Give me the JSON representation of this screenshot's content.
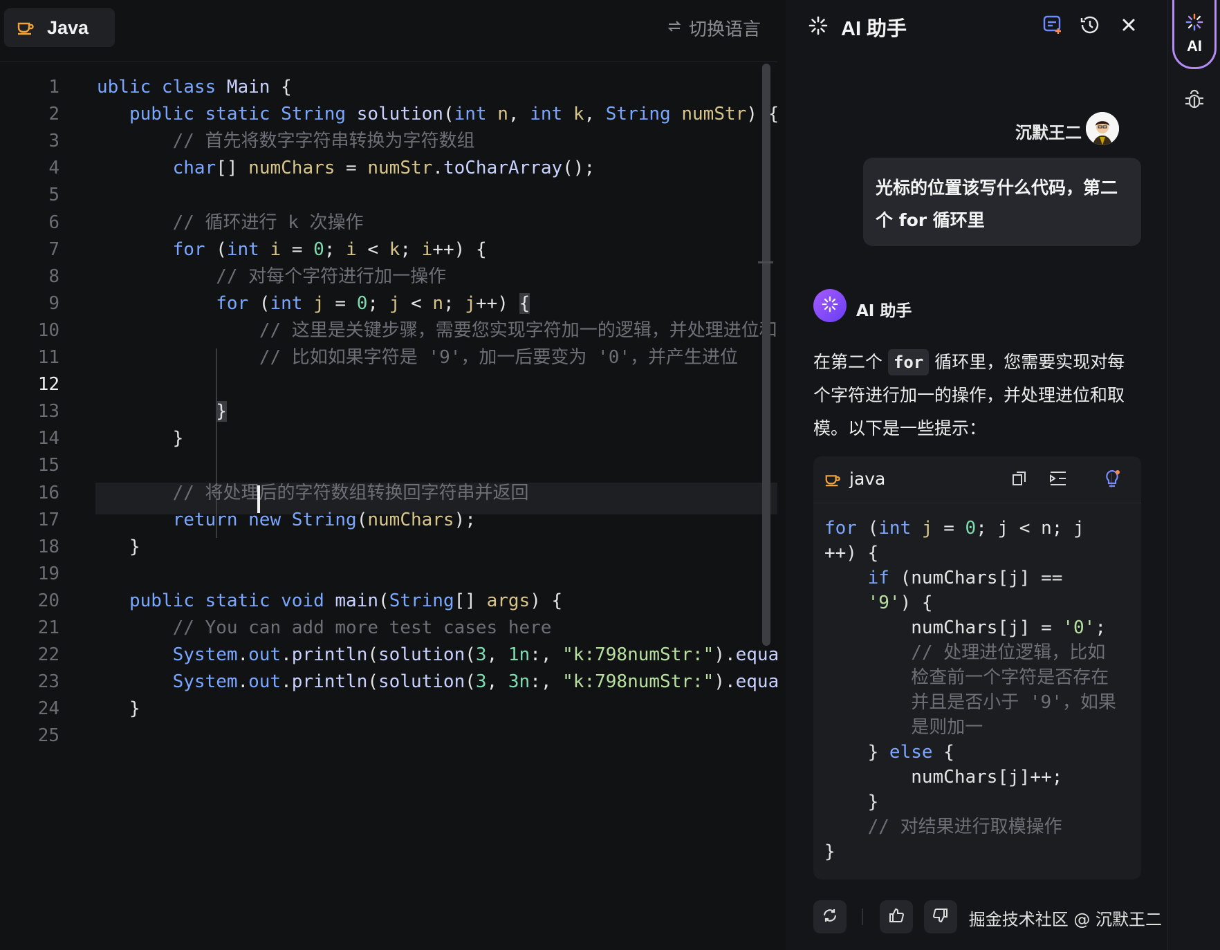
{
  "editor": {
    "language_tab": "Java",
    "switch_language": "切换语言",
    "lines": [
      {
        "n": "1",
        "segs": [
          [
            "kw",
            "ublic "
          ],
          [
            "kw",
            "class "
          ],
          [
            "fn",
            "Main"
          ],
          [
            "pl",
            " {"
          ]
        ]
      },
      {
        "n": "2",
        "segs": [
          [
            "pl",
            "   "
          ],
          [
            "kw",
            "public "
          ],
          [
            "kw",
            "static "
          ],
          [
            "ty",
            "String "
          ],
          [
            "fn",
            "solution"
          ],
          [
            "pl",
            "("
          ],
          [
            "kw",
            "int "
          ],
          [
            "id",
            "n"
          ],
          [
            "pl",
            ", "
          ],
          [
            "kw",
            "int "
          ],
          [
            "id",
            "k"
          ],
          [
            "pl",
            ", "
          ],
          [
            "ty",
            "String "
          ],
          [
            "id",
            "numStr"
          ],
          [
            "pl",
            ") {"
          ]
        ]
      },
      {
        "n": "3",
        "segs": [
          [
            "pl",
            "       "
          ],
          [
            "cm",
            "// 首先将数字字符串转换为字符数组"
          ]
        ]
      },
      {
        "n": "4",
        "segs": [
          [
            "pl",
            "       "
          ],
          [
            "kw",
            "char"
          ],
          [
            "pl",
            "[] "
          ],
          [
            "id",
            "numChars"
          ],
          [
            "pl",
            " = "
          ],
          [
            "id",
            "numStr"
          ],
          [
            "pl",
            "."
          ],
          [
            "fn",
            "toCharArray"
          ],
          [
            "pl",
            "();"
          ]
        ]
      },
      {
        "n": "5",
        "segs": []
      },
      {
        "n": "6",
        "segs": [
          [
            "pl",
            "       "
          ],
          [
            "cm",
            "// 循环进行 k 次操作"
          ]
        ]
      },
      {
        "n": "7",
        "segs": [
          [
            "pl",
            "       "
          ],
          [
            "kw",
            "for"
          ],
          [
            "pl",
            " ("
          ],
          [
            "kw",
            "int "
          ],
          [
            "id",
            "i"
          ],
          [
            "pl",
            " = "
          ],
          [
            "nm",
            "0"
          ],
          [
            "pl",
            "; "
          ],
          [
            "id",
            "i"
          ],
          [
            "pl",
            " < "
          ],
          [
            "id",
            "k"
          ],
          [
            "pl",
            "; "
          ],
          [
            "id",
            "i"
          ],
          [
            "pl",
            "++) {"
          ]
        ]
      },
      {
        "n": "8",
        "segs": [
          [
            "pl",
            "           "
          ],
          [
            "cm",
            "// 对每个字符进行加一操作"
          ]
        ]
      },
      {
        "n": "9",
        "segs": [
          [
            "pl",
            "           "
          ],
          [
            "kw",
            "for"
          ],
          [
            "pl",
            " ("
          ],
          [
            "kw",
            "int "
          ],
          [
            "id",
            "j"
          ],
          [
            "pl",
            " = "
          ],
          [
            "nm",
            "0"
          ],
          [
            "pl",
            "; "
          ],
          [
            "id",
            "j"
          ],
          [
            "pl",
            " < "
          ],
          [
            "id",
            "n"
          ],
          [
            "pl",
            "; "
          ],
          [
            "id",
            "j"
          ],
          [
            "pl",
            "++) "
          ],
          [
            "br",
            "{"
          ]
        ]
      },
      {
        "n": "10",
        "segs": [
          [
            "pl",
            "               "
          ],
          [
            "cm",
            "// 这里是关键步骤，需要您实现字符加一的逻辑，并处理进位和"
          ]
        ]
      },
      {
        "n": "11",
        "segs": [
          [
            "pl",
            "               "
          ],
          [
            "cm",
            "// 比如如果字符是 '9'，加一后要变为 '0'，并产生进位"
          ]
        ]
      },
      {
        "n": "12",
        "segs": []
      },
      {
        "n": "13",
        "segs": [
          [
            "pl",
            "           "
          ],
          [
            "br",
            "}"
          ]
        ]
      },
      {
        "n": "14",
        "segs": [
          [
            "pl",
            "       }"
          ]
        ]
      },
      {
        "n": "15",
        "segs": []
      },
      {
        "n": "16",
        "segs": [
          [
            "pl",
            "       "
          ],
          [
            "cm",
            "// 将处理后的字符数组转换回字符串并返回"
          ]
        ]
      },
      {
        "n": "17",
        "segs": [
          [
            "pl",
            "       "
          ],
          [
            "kw",
            "return "
          ],
          [
            "kw",
            "new "
          ],
          [
            "ty",
            "String"
          ],
          [
            "pl",
            "("
          ],
          [
            "id",
            "numChars"
          ],
          [
            "pl",
            ");"
          ]
        ]
      },
      {
        "n": "18",
        "segs": [
          [
            "pl",
            "   }"
          ]
        ]
      },
      {
        "n": "19",
        "segs": []
      },
      {
        "n": "20",
        "segs": [
          [
            "pl",
            "   "
          ],
          [
            "kw",
            "public "
          ],
          [
            "kw",
            "static "
          ],
          [
            "kw",
            "void "
          ],
          [
            "fn",
            "main"
          ],
          [
            "pl",
            "("
          ],
          [
            "ty",
            "String"
          ],
          [
            "pl",
            "[] "
          ],
          [
            "id",
            "args"
          ],
          [
            "pl",
            ") {"
          ]
        ]
      },
      {
        "n": "21",
        "segs": [
          [
            "pl",
            "       "
          ],
          [
            "cm",
            "// You can add more test cases here"
          ]
        ]
      },
      {
        "n": "22",
        "segs": [
          [
            "pl",
            "       "
          ],
          [
            "ty",
            "System"
          ],
          [
            "pl",
            "."
          ],
          [
            "kw",
            "out"
          ],
          [
            "pl",
            "."
          ],
          [
            "fn",
            "println"
          ],
          [
            "pl",
            "("
          ],
          [
            "fn",
            "solution"
          ],
          [
            "pl",
            "("
          ],
          [
            "nm",
            "3"
          ],
          [
            "pl",
            ", "
          ],
          [
            "nm",
            "1n"
          ],
          [
            "pl",
            ":, "
          ],
          [
            "st",
            "\"k:798numStr:\""
          ],
          [
            "pl",
            ")."
          ],
          [
            "fn",
            "equa"
          ]
        ]
      },
      {
        "n": "23",
        "segs": [
          [
            "pl",
            "       "
          ],
          [
            "ty",
            "System"
          ],
          [
            "pl",
            "."
          ],
          [
            "kw",
            "out"
          ],
          [
            "pl",
            "."
          ],
          [
            "fn",
            "println"
          ],
          [
            "pl",
            "("
          ],
          [
            "fn",
            "solution"
          ],
          [
            "pl",
            "("
          ],
          [
            "nm",
            "3"
          ],
          [
            "pl",
            ", "
          ],
          [
            "nm",
            "3n"
          ],
          [
            "pl",
            ":, "
          ],
          [
            "st",
            "\"k:798numStr:\""
          ],
          [
            "pl",
            ")."
          ],
          [
            "fn",
            "equa"
          ]
        ]
      },
      {
        "n": "24",
        "segs": [
          [
            "pl",
            "   }"
          ]
        ]
      },
      {
        "n": "25",
        "segs": []
      }
    ],
    "active_line": "12"
  },
  "assistant": {
    "title": "AI 助手",
    "user_name": "沉默王二",
    "user_message": "光标的位置该写什么代码，第二个 for 循环里",
    "ai_name": "AI 助手",
    "reply_before_code": "在第二个 ",
    "reply_inline_code": "for",
    "reply_after_code": " 循环里，您需要实现对每个字符进行加一的操作，并处理进位和取模。以下是一些提示：",
    "code_block": {
      "language": "java",
      "lines": [
        [
          [
            "kw",
            "for"
          ],
          [
            "pl",
            " ("
          ],
          [
            "kw",
            "int "
          ],
          [
            "id",
            "j"
          ],
          [
            "pl",
            " = "
          ],
          [
            "nm",
            "0"
          ],
          [
            "pl",
            "; j < n; j"
          ]
        ],
        [
          [
            "pl",
            "++) {"
          ]
        ],
        [
          [
            "pl",
            "    "
          ],
          [
            "kw",
            "if"
          ],
          [
            "pl",
            " (numChars[j] =="
          ]
        ],
        [
          [
            "pl",
            "    "
          ],
          [
            "st",
            "'9'"
          ],
          [
            "pl",
            ") {"
          ]
        ],
        [
          [
            "pl",
            "        numChars[j] = "
          ],
          [
            "st",
            "'0'"
          ],
          [
            "pl",
            ";"
          ]
        ],
        [
          [
            "pl",
            "        "
          ],
          [
            "cm",
            "// 处理进位逻辑，比如"
          ]
        ],
        [
          [
            "pl",
            "        "
          ],
          [
            "cm",
            "检查前一个字符是否存在"
          ]
        ],
        [
          [
            "pl",
            "        "
          ],
          [
            "cm",
            "并且是否小于 '9'，如果"
          ]
        ],
        [
          [
            "pl",
            "        "
          ],
          [
            "cm",
            "是则加一"
          ]
        ],
        [
          [
            "pl",
            "    } "
          ],
          [
            "kw",
            "else"
          ],
          [
            "pl",
            " {"
          ]
        ],
        [
          [
            "pl",
            "        numChars[j]++;"
          ]
        ],
        [
          [
            "pl",
            "    }"
          ]
        ],
        [
          [
            "pl",
            "    "
          ],
          [
            "cm",
            "// 对结果进行取模操作"
          ]
        ],
        [
          [
            "pl",
            "}"
          ]
        ]
      ]
    },
    "watermark": "掘金技术社区 @ 沉默王二"
  },
  "rail": {
    "ai_label": "AI"
  },
  "colors": {
    "keyword": "#7aa7ff",
    "comment": "#6d6f76",
    "number": "#7ddcb1",
    "string": "#b8e0a0",
    "ai_accent": "#b48cf5"
  }
}
